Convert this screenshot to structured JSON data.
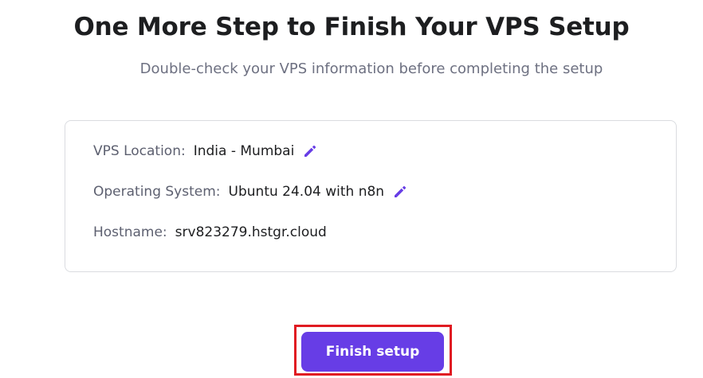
{
  "header": {
    "title": "One More Step to Finish Your VPS Setup",
    "subtitle": "Double-check your VPS information before completing the setup"
  },
  "summary": {
    "location": {
      "label": "VPS Location:",
      "value": "India - Mumbai",
      "icon": "pencil-edit-icon"
    },
    "operating_system": {
      "label": "Operating System:",
      "value": "Ubuntu 24.04 with n8n",
      "icon": "pencil-edit-icon"
    },
    "hostname": {
      "label": "Hostname:",
      "value": "srv823279.hstgr.cloud"
    }
  },
  "actions": {
    "finish_label": "Finish setup"
  },
  "colors": {
    "accent": "#673de6",
    "highlight": "#e01b22"
  }
}
